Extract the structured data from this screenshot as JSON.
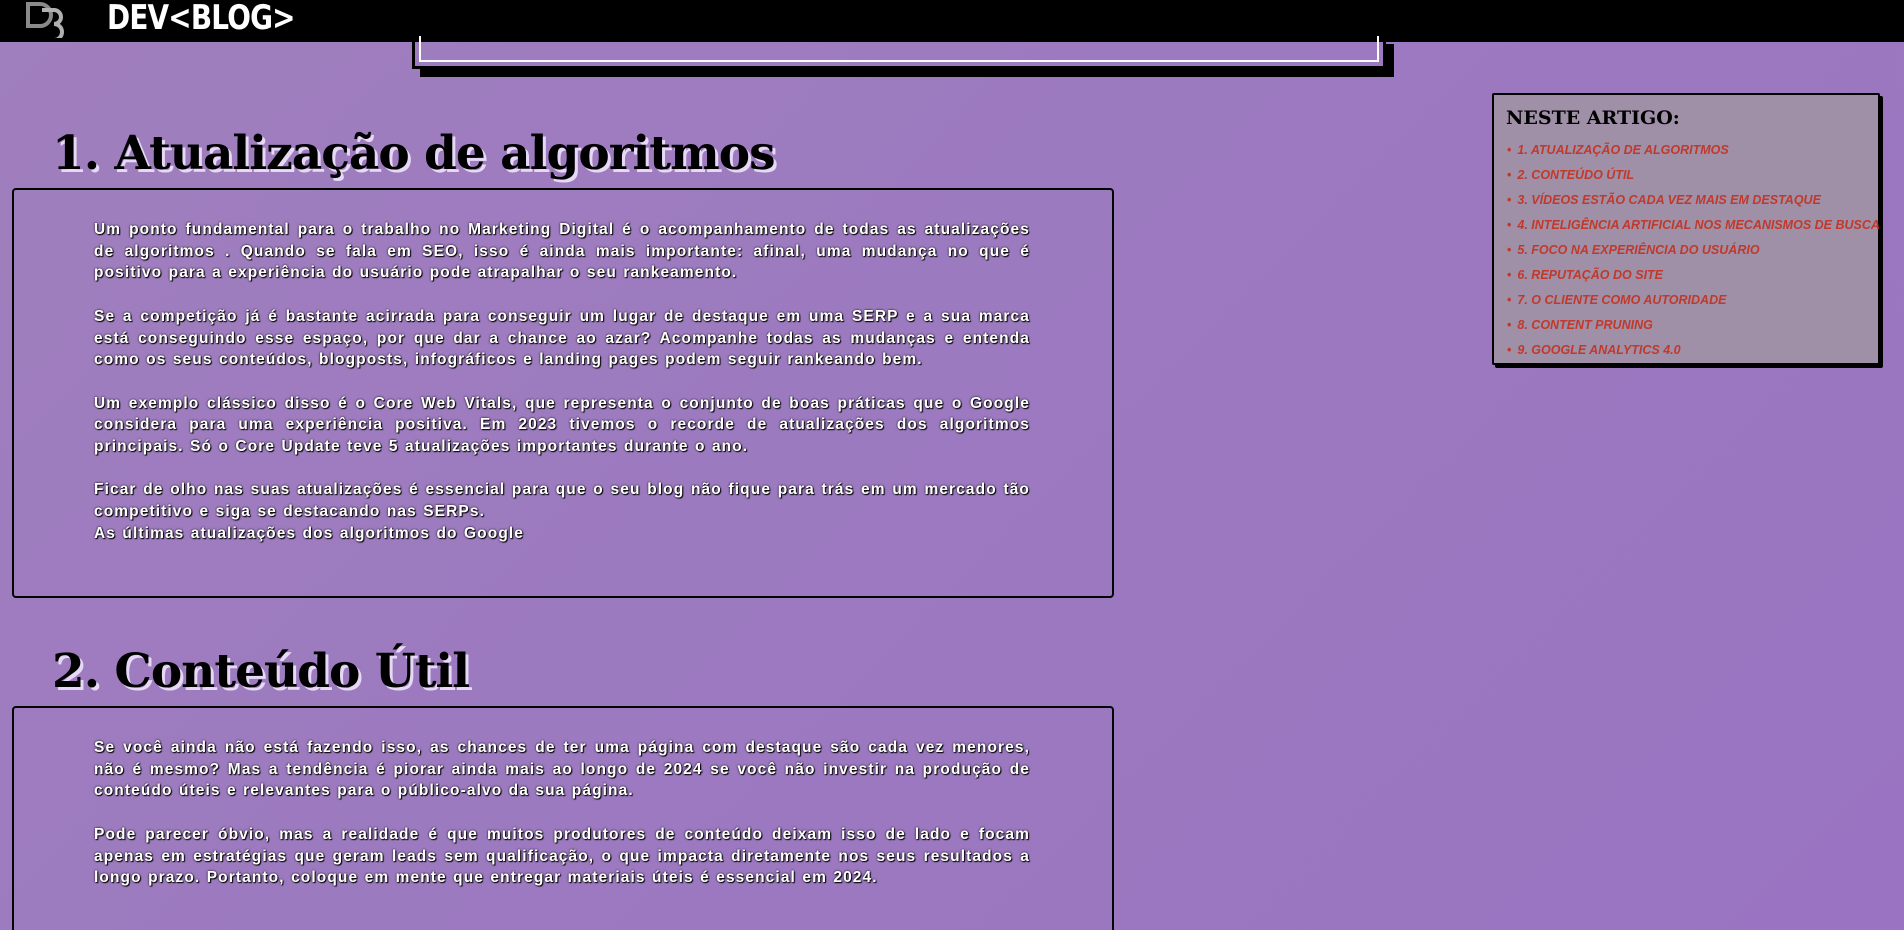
{
  "header": {
    "brand": "DEV<BLOG>"
  },
  "sections": [
    {
      "title": "1. Atualização de algoritmos",
      "paragraphs": [
        {
          "pre": " Um ponto fundamental para o trabalho no Marketing Digital é o ",
          "highlight": " acompanhamento de todas as atualizações de algoritmos ",
          "post": ". Quando se fala em SEO, isso é ainda mais importante: afinal, uma mudança no que é positivo para a experiência do usuário pode atrapalhar o seu rankeamento."
        },
        {
          "text": " Se a competição já é bastante acirrada para conseguir um lugar de destaque em uma SERP e a sua marca está conseguindo esse espaço, por que dar a chance ao azar? Acompanhe todas as mudanças e entenda como os seus conteúdos, blogposts, infográficos e landing pages podem seguir rankeando bem."
        },
        {
          "text": " Um exemplo clássico disso é o Core Web Vitals, que representa o conjunto de boas práticas que o Google considera para uma experiência positiva. Em 2023 tivemos o recorde de atualizações dos algoritmos principais. Só o Core Update teve 5 atualizações importantes durante o ano."
        },
        {
          "text": " Ficar de olho nas suas atualizações é essencial para que o seu blog não fique para trás em um mercado tão competitivo e siga se destacando nas SERPs."
        },
        {
          "text": "As últimas atualizações dos algoritmos do Google"
        }
      ]
    },
    {
      "title": "2. Conteúdo Útil",
      "paragraphs": [
        {
          "pre": " Se você ainda não está fazendo isso, as chances de ter uma página com destaque são cada vez menores, não é mesmo? Mas a tendência é piorar ainda mais ao longo de 2024 se você não ",
          "highlight": " investir na produção de conteúdo úteis e relevantes ",
          "post": " para o público-alvo da sua página."
        },
        {
          "text": "Pode parecer óbvio, mas a realidade é que muitos produtores de conteúdo deixam isso de lado e focam apenas em estratégias que geram leads sem qualificação, o que impacta diretamente nos seus resultados a longo prazo. Portanto, coloque em mente que entregar materiais úteis é essencial em 2024."
        }
      ]
    }
  ],
  "toc": {
    "title": "NESTE ARTIGO:",
    "items": [
      "1. ATUALIZAÇÃO DE ALGORITMOS",
      "2. CONTEÚDO ÚTIL",
      "3. VÍDEOS ESTÃO CADA VEZ MAIS EM DESTAQUE",
      "4. INTELIGÊNCIA ARTIFICIAL NOS MECANISMOS DE BUSCA",
      "5. FOCO NA EXPERIÊNCIA DO USUÁRIO",
      "6. REPUTAÇÃO DO SITE",
      "7. O CLIENTE COMO AUTORIDADE",
      "8. CONTENT PRUNING",
      "9. GOOGLE ANALYTICS 4.0"
    ],
    "bullet": "•",
    "color": "#c0392b"
  },
  "colors": {
    "background": "#9b78c0",
    "topbar": "#000000",
    "text": "#ffffff"
  }
}
